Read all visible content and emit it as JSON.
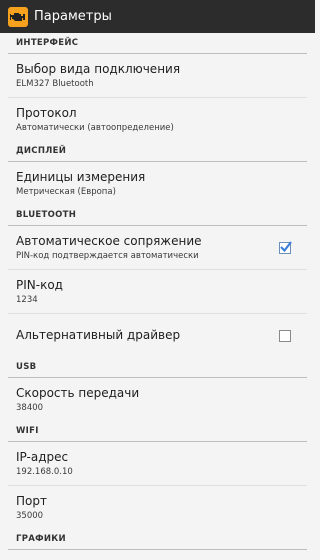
{
  "app": {
    "title": "Параметры",
    "icon": "engine-warning-icon",
    "accent": "#f6a21e"
  },
  "sections": {
    "interface": {
      "header": "ИНТЕРФЕЙС",
      "connection_type": {
        "title": "Выбор вида подключения",
        "summary": "ELM327 Bluetooth"
      },
      "protocol": {
        "title": "Протокол",
        "summary": "Автоматически (автоопределение)"
      }
    },
    "display": {
      "header": "ДИСПЛЕЙ",
      "units": {
        "title": "Единицы измерения",
        "summary": "Метрическая (Европа)"
      }
    },
    "bluetooth": {
      "header": "BLUETOOTH",
      "auto_pair": {
        "title": "Автоматическое сопряжение",
        "summary": "PIN-код подтверждается автоматически",
        "checked": true
      },
      "pin": {
        "title": "PIN-код",
        "summary": "1234"
      },
      "alt_driver": {
        "title": "Альтернативный драйвер",
        "checked": false
      }
    },
    "usb": {
      "header": "USB",
      "baud": {
        "title": "Скорость передачи",
        "summary": "38400"
      }
    },
    "wifi": {
      "header": "WIFI",
      "ip": {
        "title": "IP-адрес",
        "summary": "192.168.0.10"
      },
      "port": {
        "title": "Порт",
        "summary": "35000"
      }
    },
    "graphics": {
      "header": "ГРАФИКИ"
    }
  }
}
